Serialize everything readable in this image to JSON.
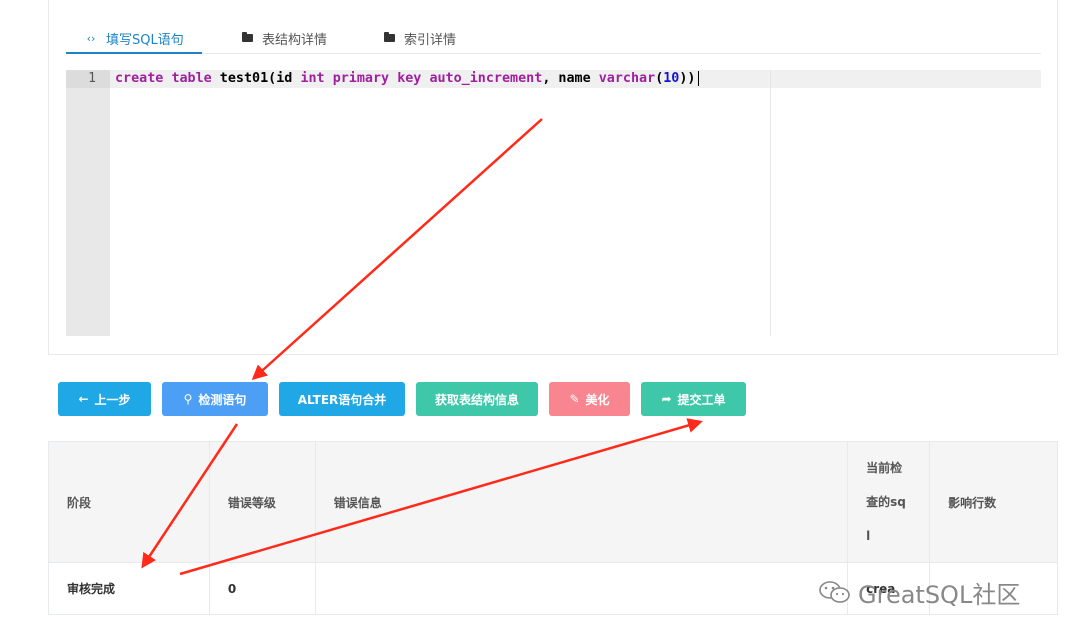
{
  "tabs": [
    {
      "label": "填写SQL语句",
      "icon": "code-icon"
    },
    {
      "label": "表结构详情",
      "icon": "folder-icon"
    },
    {
      "label": "索引详情",
      "icon": "folder-icon"
    }
  ],
  "editor": {
    "line_number": "1",
    "tokens": {
      "t1": "create",
      "t2": " ",
      "t3": "table",
      "t4": " test01(id ",
      "t5": "int",
      "t6": " ",
      "t7": "primary",
      "t8": " ",
      "t9": "key",
      "t10": " ",
      "t11": "auto_increment",
      "t12": ", name ",
      "t13": "varchar",
      "t14": "(",
      "t15": "10",
      "t16": "))"
    }
  },
  "buttons": [
    {
      "label": "上一步",
      "icon": "arrow-left-icon",
      "color": "#1fa7e6"
    },
    {
      "label": "检测语句",
      "icon": "search-icon",
      "color": "#4d9ff5"
    },
    {
      "label": "ALTER语句合并",
      "icon": "",
      "color": "#1fa7e6"
    },
    {
      "label": "获取表结构信息",
      "icon": "",
      "color": "#3fc7a9"
    },
    {
      "label": "美化",
      "icon": "pencil-icon",
      "color": "#f8858f"
    },
    {
      "label": "提交工单",
      "icon": "share-icon",
      "color": "#3fc7a9"
    }
  ],
  "table": {
    "headers": [
      "阶段",
      "错误等级",
      "错误信息",
      "当前检查的sql",
      "影响行数"
    ],
    "header_sql_lines": [
      "当前检",
      "查的sq",
      "l"
    ],
    "rows": [
      [
        "审核完成",
        "0",
        "",
        "crea",
        ""
      ]
    ]
  },
  "watermark": "GreatSQL社区",
  "colors": {
    "accent": "#1c84c6",
    "arrow": "#ff2a1a"
  }
}
